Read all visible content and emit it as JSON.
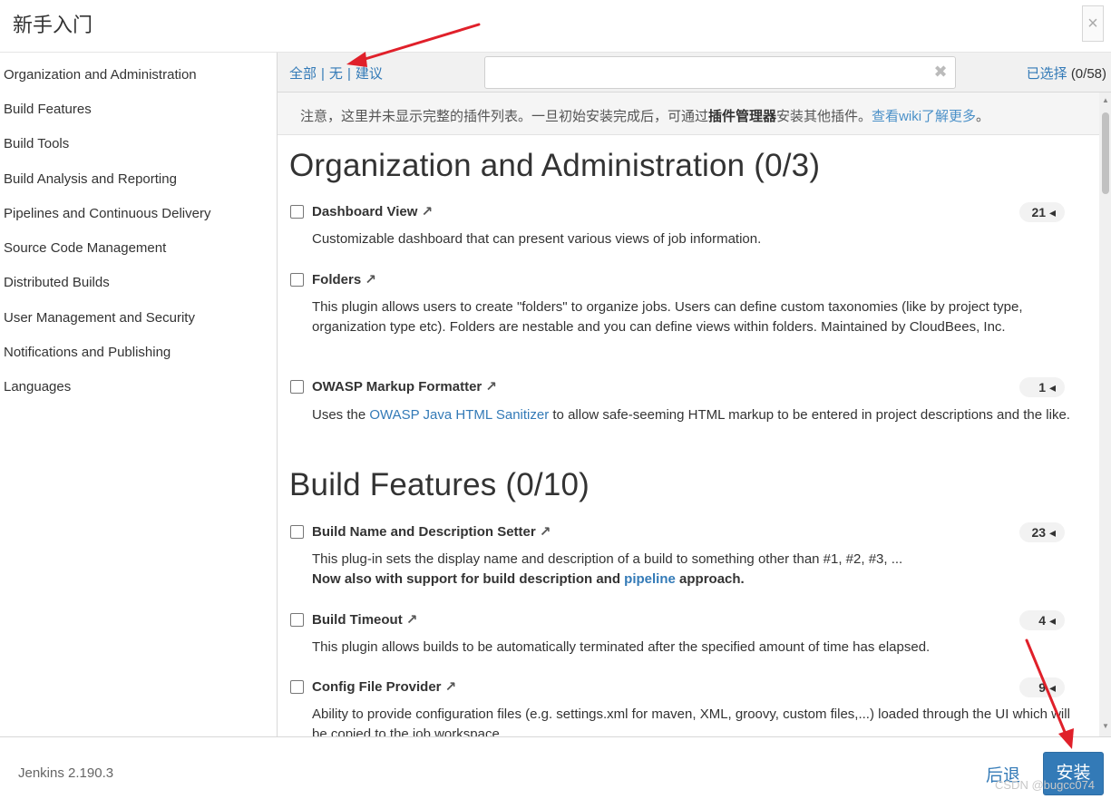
{
  "header": {
    "title": "新手入门",
    "close_label": "×"
  },
  "sidebar": {
    "items": [
      "Organization and Administration",
      "Build Features",
      "Build Tools",
      "Build Analysis and Reporting",
      "Pipelines and Continuous Delivery",
      "Source Code Management",
      "Distributed Builds",
      "User Management and Security",
      "Notifications and Publishing",
      "Languages"
    ]
  },
  "toolbar": {
    "all": "全部",
    "none": "无",
    "suggested": "建议",
    "separator": "|",
    "search_value": "",
    "clear_label": "✖",
    "selected_label": "已选择",
    "selected_count": "(0/58)"
  },
  "notice": {
    "part1": "注意，这里并未显示完整的插件列表。一旦初始安装完成后，可通过",
    "bold": "插件管理器",
    "part2": "安装其他插件。",
    "link": "查看wiki了解更多",
    "end": "。"
  },
  "sections": [
    {
      "title": "Organization and Administration (0/3)"
    },
    {
      "title": "Build Features (0/10)"
    }
  ],
  "plugins": [
    {
      "name": "Dashboard View",
      "badge": "21",
      "desc": "Customizable dashboard that can present various views of job information."
    },
    {
      "name": "Folders",
      "badge": "",
      "desc": "This plugin allows users to create \"folders\" to organize jobs. Users can define custom taxonomies (like by project type, organization type etc). Folders are nestable and you can define views within folders. Maintained by CloudBees, Inc."
    },
    {
      "name": "OWASP Markup Formatter",
      "badge": "1",
      "desc_pre": "Uses the ",
      "desc_link": "OWASP Java HTML Sanitizer",
      "desc_post": " to allow safe-seeming HTML markup to be entered in project descriptions and the like."
    },
    {
      "name": "Build Name and Description Setter",
      "badge": "23",
      "desc": "This plug-in sets the display name and description of a build to something other than #1, #2, #3, ...",
      "desc2_pre": "Now also with support for build description and ",
      "desc2_link": "pipeline",
      "desc2_post": " approach."
    },
    {
      "name": "Build Timeout",
      "badge": "4",
      "desc": "This plugin allows builds to be automatically terminated after the specified amount of time has elapsed."
    },
    {
      "name": "Config File Provider",
      "badge": "9",
      "desc": "Ability to provide configuration files (e.g. settings.xml for maven, XML, groovy, custom files,...) loaded through the UI which will be copied to the job workspace."
    }
  ],
  "icons": {
    "external_link": "external-link-icon",
    "badge_caret": "caret-left-icon",
    "annotation": "red-arrow"
  },
  "colors": {
    "link": "#337ab7",
    "annotation": "#e0202a",
    "button": "#337ab7"
  },
  "footer": {
    "version": "Jenkins 2.190.3",
    "back_label": "后退",
    "install_label": "安装",
    "watermark": "CSDN @bugcc074"
  }
}
